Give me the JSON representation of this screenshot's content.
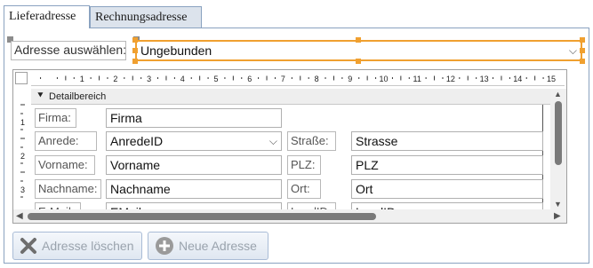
{
  "tabs": [
    {
      "label": "Lieferadresse",
      "active": true
    },
    {
      "label": "Rechnungsadresse",
      "active": false
    }
  ],
  "address_select": {
    "label": "Adresse auswählen:",
    "value": "Ungebunden"
  },
  "ruler": {
    "numbers": [
      "1",
      "2",
      "3",
      "4",
      "5",
      "6",
      "7",
      "8",
      "9",
      "10",
      "11",
      "12",
      "13",
      "14",
      "15"
    ],
    "side_numbers": [
      "1",
      "2",
      "3"
    ]
  },
  "section": {
    "title": "Detailbereich"
  },
  "form": {
    "firma": {
      "label": "Firma:",
      "value": "Firma"
    },
    "anrede": {
      "label": "Anrede:",
      "value": "AnredeID"
    },
    "vorname": {
      "label": "Vorname:",
      "value": "Vorname"
    },
    "nachname": {
      "label": "Nachname:",
      "value": "Nachname"
    },
    "email": {
      "label": "E-Mail:",
      "value": "EMail"
    },
    "strasse": {
      "label": "Straße:",
      "value": "Strasse"
    },
    "plz": {
      "label": "PLZ:",
      "value": "PLZ"
    },
    "ort": {
      "label": "Ort:",
      "value": "Ort"
    },
    "land": {
      "label": "LandID:",
      "value": "LandID"
    }
  },
  "buttons": {
    "delete": {
      "label": "Adresse löschen"
    },
    "new": {
      "label": "Neue Adresse"
    }
  },
  "colors": {
    "accent": "#f0a030",
    "border": "#8aa2c0",
    "disabled_text": "#9aa3ad"
  }
}
